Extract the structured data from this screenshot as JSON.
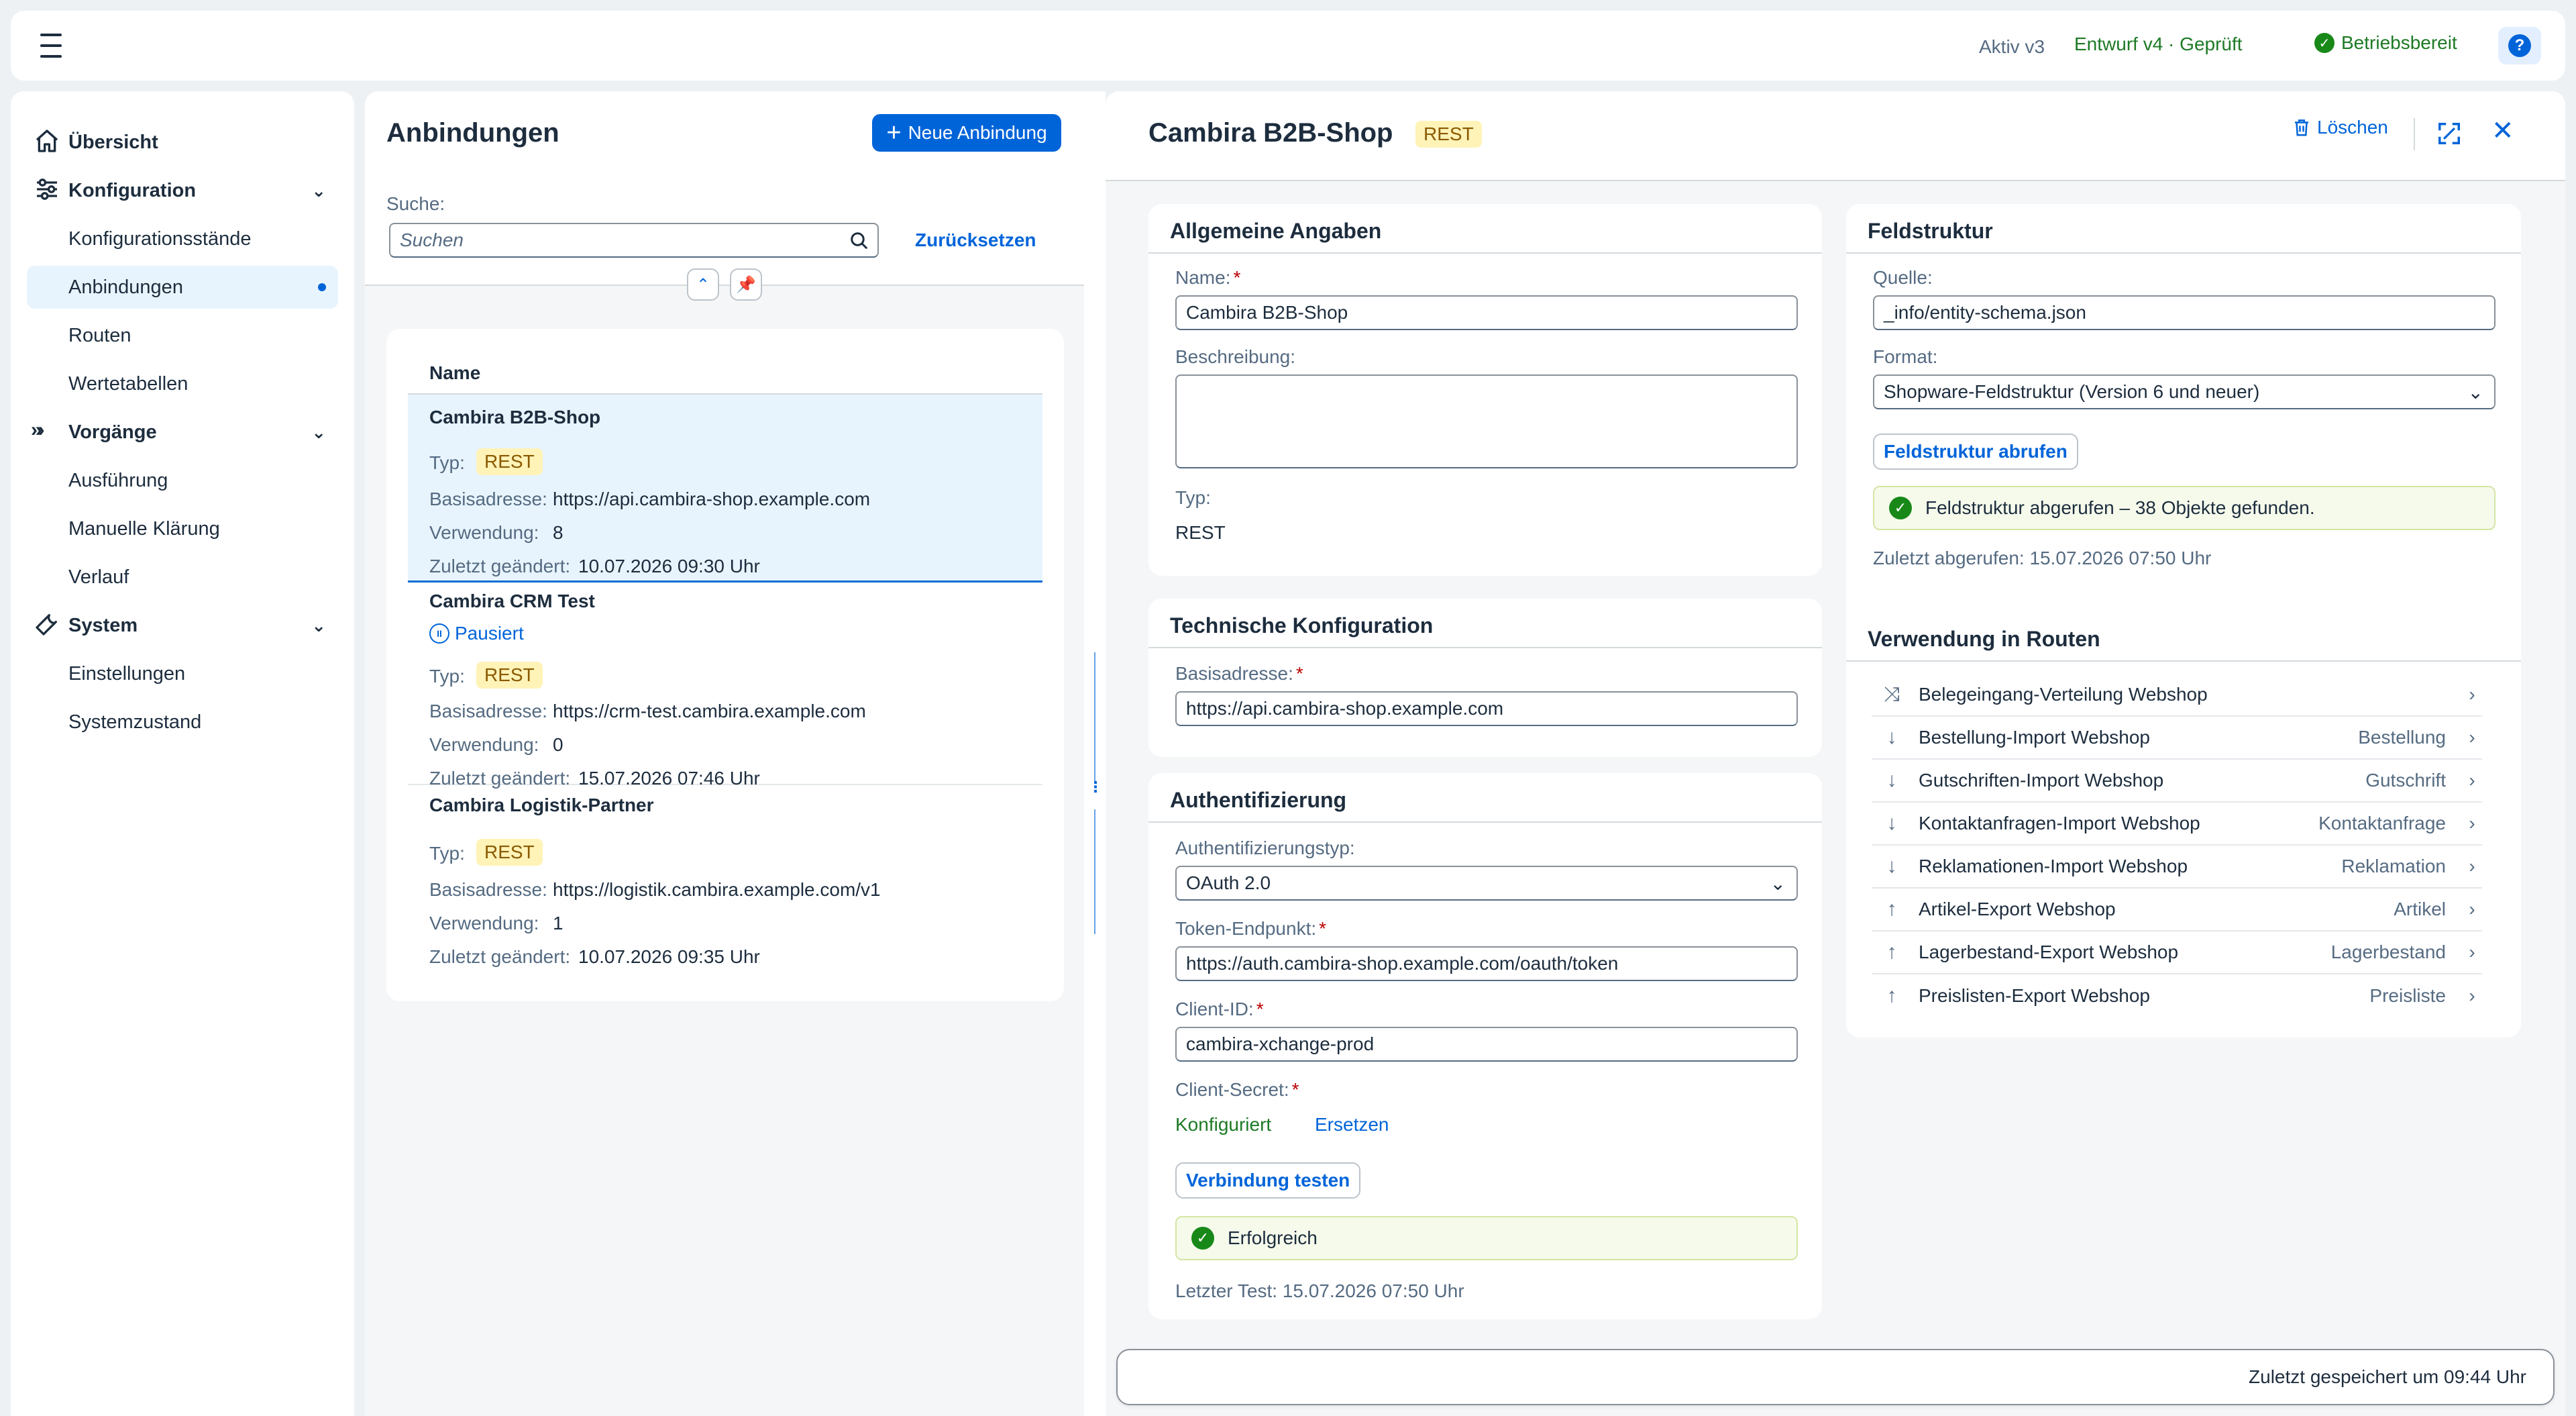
{
  "topbar": {
    "menu_icon": "hamburger-icon",
    "active_version": "Aktiv v3",
    "draft_version": "Entwurf v4 · Geprüft",
    "status": "Betriebsbereit",
    "help_icon": "help-icon"
  },
  "nav": {
    "items": [
      {
        "label": "Übersicht",
        "type": "top",
        "icon": "home-icon"
      },
      {
        "label": "Konfiguration",
        "type": "group",
        "icon": "sliders-icon"
      },
      {
        "label": "Konfigurationsstände",
        "type": "sub"
      },
      {
        "label": "Anbindungen",
        "type": "sub",
        "selected": true
      },
      {
        "label": "Routen",
        "type": "sub"
      },
      {
        "label": "Wertetabellen",
        "type": "sub"
      },
      {
        "label": "Vorgänge",
        "type": "group",
        "icon": "process-icon"
      },
      {
        "label": "Ausführung",
        "type": "sub"
      },
      {
        "label": "Manuelle Klärung",
        "type": "sub"
      },
      {
        "label": "Verlauf",
        "type": "sub"
      },
      {
        "label": "System",
        "type": "group",
        "icon": "wrench-icon"
      },
      {
        "label": "Einstellungen",
        "type": "sub"
      },
      {
        "label": "Systemzustand",
        "type": "sub"
      }
    ]
  },
  "list": {
    "title": "Anbindungen",
    "new_button": "Neue Anbindung",
    "search_label": "Suche:",
    "search_placeholder": "Suchen",
    "reset_label": "Zurücksetzen",
    "column_header": "Name",
    "labels": {
      "type": "Typ:",
      "base": "Basisadresse:",
      "usage": "Verwendung:",
      "changed": "Zuletzt geändert:"
    },
    "rows": [
      {
        "name": "Cambira B2B-Shop",
        "status": "",
        "type": "REST",
        "base": "https://api.cambira-shop.example.com",
        "usage": "8",
        "changed": "10.07.2026 09:30 Uhr"
      },
      {
        "name": "Cambira CRM Test",
        "status": "Pausiert",
        "type": "REST",
        "base": "https://crm-test.cambira.example.com",
        "usage": "0",
        "changed": "15.07.2026 07:46 Uhr"
      },
      {
        "name": "Cambira Logistik-Partner",
        "status": "",
        "type": "REST",
        "base": "https://logistik.cambira.example.com/v1",
        "usage": "1",
        "changed": "10.07.2026 09:35 Uhr"
      }
    ]
  },
  "detail": {
    "title": "Cambira B2B-Shop",
    "type_badge": "REST",
    "delete_label": "Löschen",
    "general": {
      "title": "Allgemeine Angaben",
      "name_label": "Name:",
      "name_value": "Cambira B2B-Shop",
      "description_label": "Beschreibung:",
      "description_value": "",
      "type_label": "Typ:",
      "type_value": "REST"
    },
    "technical": {
      "title": "Technische Konfiguration",
      "base_label": "Basisadresse:",
      "base_value": "https://api.cambira-shop.example.com"
    },
    "auth": {
      "title": "Authentifizierung",
      "type_label": "Authentifizierungstyp:",
      "type_value": "OAuth 2.0",
      "token_label": "Token-Endpunkt:",
      "token_value": "https://auth.cambira-shop.example.com/oauth/token",
      "client_id_label": "Client-ID:",
      "client_id_value": "cambira-xchange-prod",
      "secret_label": "Client-Secret:",
      "secret_status": "Konfiguriert",
      "secret_replace": "Ersetzen",
      "test_button": "Verbindung testen",
      "test_result": "Erfolgreich",
      "last_test": "Letzter Test: 15.07.2026 07:50 Uhr"
    },
    "structure": {
      "title": "Feldstruktur",
      "source_label": "Quelle:",
      "source_value": "_info/entity-schema.json",
      "format_label": "Format:",
      "format_value": "Shopware-Feldstruktur (Version 6 und neuer)",
      "fetch_button": "Feldstruktur abrufen",
      "fetch_result": "Feldstruktur abgerufen – 38 Objekte gefunden.",
      "last_fetch": "Zuletzt abgerufen: 15.07.2026 07:50 Uhr"
    },
    "routes": {
      "title": "Verwendung in Routen",
      "items": [
        {
          "icon": "branch-icon",
          "name": "Belegeingang-Verteilung Webshop",
          "object": ""
        },
        {
          "icon": "arrow-down-icon",
          "name": "Bestellung-Import Webshop",
          "object": "Bestellung"
        },
        {
          "icon": "arrow-down-icon",
          "name": "Gutschriften-Import Webshop",
          "object": "Gutschrift"
        },
        {
          "icon": "arrow-down-icon",
          "name": "Kontaktanfragen-Import Webshop",
          "object": "Kontaktanfrage"
        },
        {
          "icon": "arrow-down-icon",
          "name": "Reklamationen-Import Webshop",
          "object": "Reklamation"
        },
        {
          "icon": "arrow-up-icon",
          "name": "Artikel-Export Webshop",
          "object": "Artikel"
        },
        {
          "icon": "arrow-up-icon",
          "name": "Lagerbestand-Export Webshop",
          "object": "Lagerbestand"
        },
        {
          "icon": "arrow-up-icon",
          "name": "Preislisten-Export Webshop",
          "object": "Preisliste"
        }
      ]
    },
    "footer": "Zuletzt gespeichert um 09:44 Uhr"
  },
  "colors": {
    "accent": "#0064d9",
    "success": "#188918",
    "badge_bg": "#fff3b8",
    "selected_row": "#e8f4fd"
  }
}
